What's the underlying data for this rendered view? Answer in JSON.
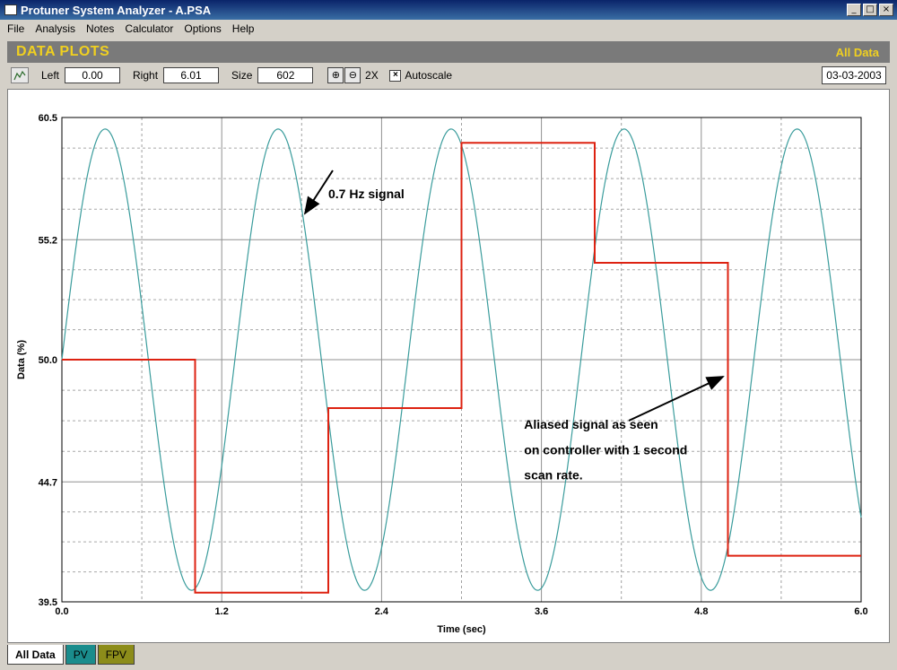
{
  "window": {
    "title": "Protuner System Analyzer - A.PSA",
    "min_glyph": "_",
    "max_glyph": "□",
    "close_glyph": "×"
  },
  "menu": [
    {
      "label": "File"
    },
    {
      "label": "Analysis"
    },
    {
      "label": "Notes"
    },
    {
      "label": "Calculator"
    },
    {
      "label": "Options"
    },
    {
      "label": "Help"
    }
  ],
  "header": {
    "title": "DATA PLOTS",
    "right": "All Data"
  },
  "toolbar": {
    "left_label": "Left",
    "left_value": "0.00",
    "right_label": "Right",
    "right_value": "6.01",
    "size_label": "Size",
    "size_value": "602",
    "zoom_in_glyph": "⊕",
    "zoom_out_glyph": "⊖",
    "twox_label": "2X",
    "autoscale_label": "Autoscale",
    "autoscale_checked": true,
    "check_glyph": "×",
    "date": "03-03-2003"
  },
  "tabs": [
    {
      "label": "All Data",
      "active": true
    },
    {
      "label": "PV",
      "active": false
    },
    {
      "label": "FPV",
      "active": false
    }
  ],
  "chart_data": {
    "type": "line",
    "xlabel": "Time (sec)",
    "ylabel": "Data (%)",
    "xlim": [
      0.0,
      6.0
    ],
    "ylim": [
      39.5,
      60.5
    ],
    "x_ticks": [
      "0.0",
      "1.2",
      "2.4",
      "3.6",
      "4.8",
      "6.0"
    ],
    "y_ticks": [
      "39.5",
      "44.7",
      "50.0",
      "55.2",
      "60.5"
    ],
    "x_tick_values": [
      0.0,
      1.2,
      2.4,
      3.6,
      4.8,
      6.0
    ],
    "y_tick_values": [
      39.5,
      44.7,
      50.0,
      55.2,
      60.5
    ],
    "grid": true,
    "series": [
      {
        "color": "#3a9c9c",
        "kind": "sine",
        "frequency_hz": 0.77,
        "center": 50.0,
        "amplitude": 10.0,
        "phase_start": 0
      },
      {
        "color": "#dd2211",
        "kind": "step",
        "points": [
          [
            0,
            50.0
          ],
          [
            1,
            39.9
          ],
          [
            2,
            47.9
          ],
          [
            3,
            59.4
          ],
          [
            4,
            54.2
          ],
          [
            5,
            41.5
          ],
          [
            6,
            41.5
          ]
        ]
      }
    ],
    "annotations": [
      {
        "text": "0.7 Hz signal",
        "x": 2.0,
        "y": 57.0
      },
      {
        "text": "Aliased signal as seen",
        "x": 3.47,
        "y": 47.0
      },
      {
        "text": "on controller with 1 second",
        "x": 3.47,
        "y": 45.9
      },
      {
        "text": "scan rate.",
        "x": 3.47,
        "y": 44.8
      }
    ]
  }
}
